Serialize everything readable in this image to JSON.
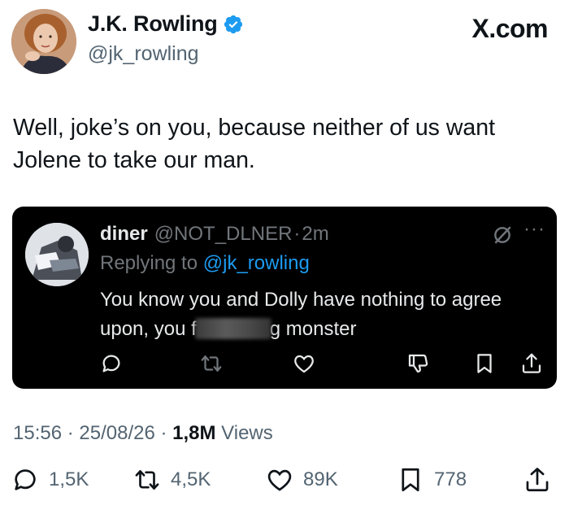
{
  "author": {
    "name": "J.K. Rowling",
    "handle": "@jk_rowling",
    "verified": true
  },
  "brand": "X.com",
  "tweet": {
    "text": "Well, joke’s on you, because neither of us want Jolene to take our man."
  },
  "quoted": {
    "name": "diner",
    "handle": "@NOT_DLNER",
    "separator": "·",
    "age": "2m",
    "replying_prefix": "Replying to",
    "replying_to": "@jk_rowling",
    "text_before": "You know you and Dolly have nothing to agree upon, you f",
    "text_after": "g monster",
    "more": "···"
  },
  "meta": {
    "time": "15:56 · 25/08/26 ·",
    "views_count": "1,8M",
    "views_label": "Views"
  },
  "stats": {
    "replies": "1,5K",
    "reposts": "4,5K",
    "likes": "89K",
    "bookmarks": "778"
  },
  "colors": {
    "accent": "#1d9bf0",
    "muted": "#536471",
    "text": "#0f1419",
    "embed_bg": "#000000"
  }
}
